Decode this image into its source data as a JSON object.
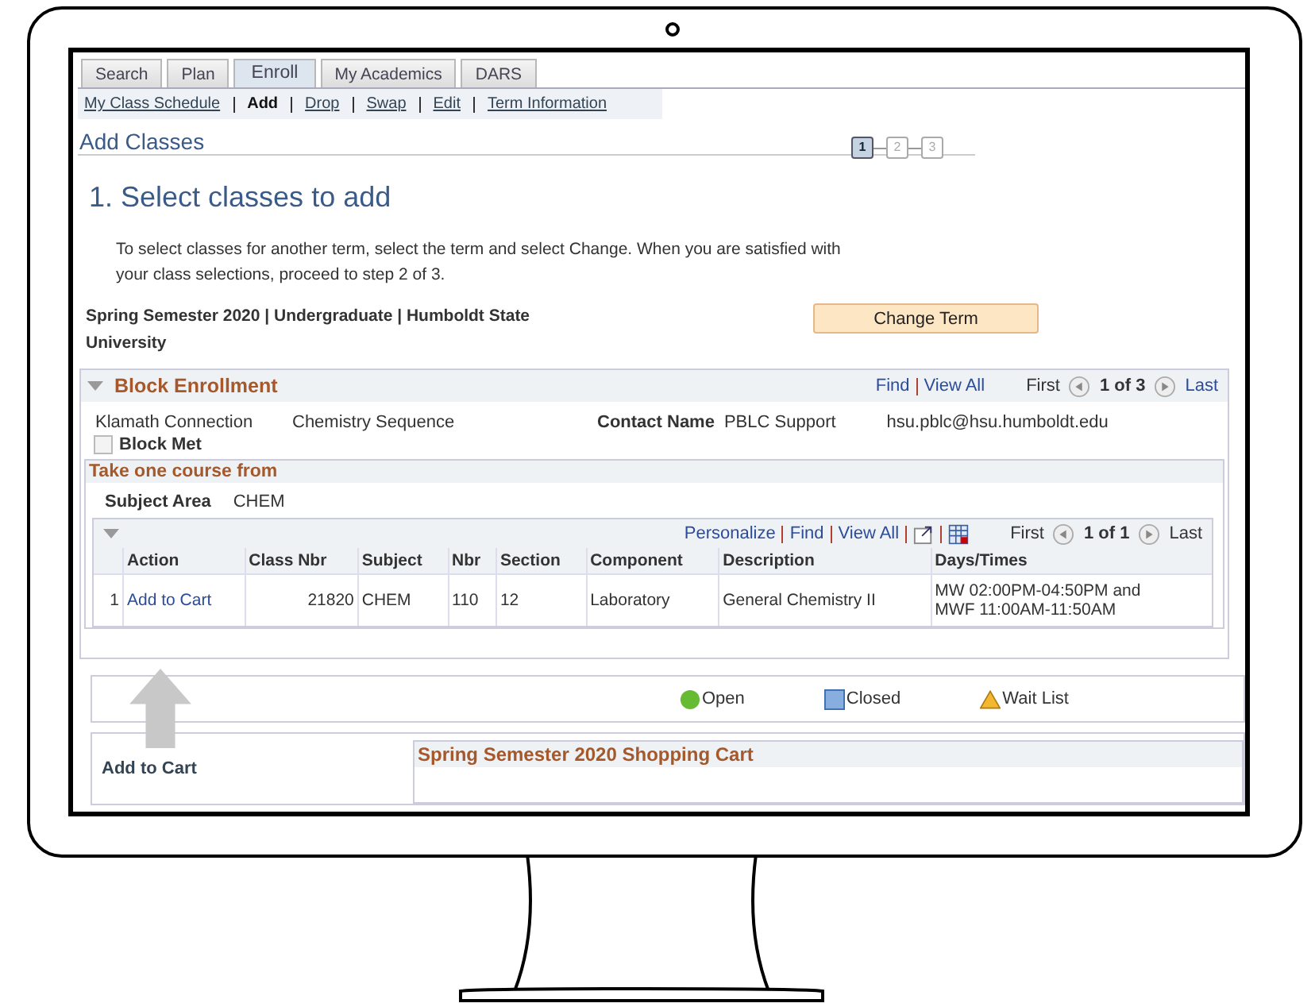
{
  "tabs": [
    {
      "label": "Search",
      "selected": false
    },
    {
      "label": "Plan",
      "selected": false
    },
    {
      "label": "Enroll",
      "selected": true
    },
    {
      "label": "My Academics",
      "selected": false
    },
    {
      "label": "DARS",
      "selected": false
    }
  ],
  "subnav": [
    {
      "label": "My Class Schedule",
      "selected": false
    },
    {
      "label": "Add",
      "selected": true
    },
    {
      "label": "Drop",
      "selected": false
    },
    {
      "label": "Swap",
      "selected": false
    },
    {
      "label": "Edit",
      "selected": false
    },
    {
      "label": "Term Information",
      "selected": false
    }
  ],
  "page_title": "Add Classes",
  "steps": [
    {
      "label": "1",
      "selected": true
    },
    {
      "label": "2",
      "selected": false
    },
    {
      "label": "3",
      "selected": false
    }
  ],
  "heading": "1.  Select classes to add",
  "instructions": "To select classes for another term, select the term and select Change.  When you are satisfied with your class selections, proceed to step 2 of 3.",
  "term": "Spring Semester 2020 | Undergraduate | Humboldt State University",
  "change_term_button": "Change Term",
  "block_enrollment": {
    "title": "Block Enrollment",
    "links": [
      "Find",
      "View All"
    ],
    "pager": {
      "first": "First",
      "position": "1 of 3",
      "last": "Last"
    },
    "block_name": "Klamath Connection",
    "sequence": "Chemistry Sequence",
    "contact_label": "Contact Name",
    "contact_name": "PBLC Support",
    "email": "hsu.pblc@hsu.humboldt.edu",
    "block_met": {
      "label": "Block Met",
      "checked": false
    },
    "group_title": "Take one course from",
    "subject_label": "Subject Area",
    "subject": "CHEM",
    "grid": {
      "links": [
        "Personalize",
        "Find",
        "View All"
      ],
      "pager": {
        "first": "First",
        "position": "1 of 1",
        "last": "Last"
      },
      "columns": [
        "Action",
        "Class Nbr",
        "Subject",
        "Nbr",
        "Section",
        "Component",
        "Description",
        "Days/Times"
      ],
      "rows": [
        {
          "index": "1",
          "action": "Add to Cart",
          "class_nbr": "21820",
          "subject": "CHEM",
          "nbr": "110",
          "section": "12",
          "component": "Laboratory",
          "description": "General Chemistry II",
          "days_times": [
            "MW 02:00PM-04:50PM and",
            "MWF 11:00AM-11:50AM"
          ]
        }
      ]
    }
  },
  "legend": [
    {
      "kind": "circle",
      "label": "Open",
      "color": "#66bb33"
    },
    {
      "kind": "square",
      "label": "Closed",
      "color": "#88aee0"
    },
    {
      "kind": "triangle",
      "label": "Wait List",
      "color": "#f2b830"
    }
  ],
  "left_label": "Add to Cart",
  "cart_title": "Spring Semester 2020 Shopping Cart"
}
